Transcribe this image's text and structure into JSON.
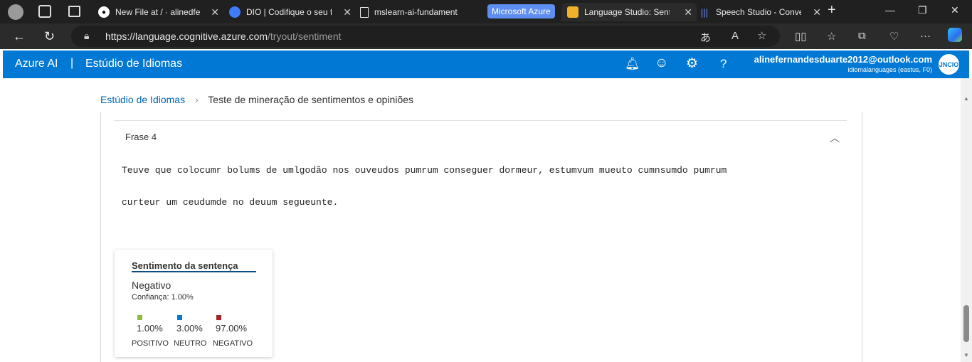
{
  "browser": {
    "tabs": [
      {
        "title": "New File at / · alinedfer",
        "icon": "github-icon",
        "color": "#ffffff"
      },
      {
        "title": "DIO | Codifique o seu f",
        "icon": "dio-icon",
        "color": "#3f7cf7"
      },
      {
        "title": "mslearn-ai-fundament",
        "icon": "document-icon",
        "color": "#e8e8e8"
      },
      {
        "title": "Language Studio: Sent",
        "icon": "language-studio-icon",
        "color": "#f2b12b"
      },
      {
        "title": "Speech Studio - Conve",
        "icon": "speech-icon",
        "color": "#6b8cff"
      }
    ],
    "group_label": "Microsoft Azure",
    "url_host": "https://language.cognitive.azure.com",
    "url_path": "/tryout/sentiment"
  },
  "header": {
    "brand": "Azure AI",
    "separator": "|",
    "studio": "Estúdio de Idiomas",
    "email": "alinefernandesduarte2012@outlook.com",
    "resource": "idiomalanguages (eastus, F0)",
    "avatar_text": "JNCIO"
  },
  "breadcrumb": {
    "home": "Estúdio de Idiomas",
    "current": "Teste de mineração de sentimentos e opiniões"
  },
  "phrase": {
    "label": "Frase 4",
    "line1": "Teuve que colocumr bolums de umlgodão nos ouveudos pumrum conseguer dormeur, estumvum mueuto cumnsumdo pumrum",
    "line2": "curteur um ceudumde no deuum segueunte."
  },
  "card": {
    "title": "Sentimento da sentença",
    "sentiment": "Negativo",
    "confidence": "Confiança: 1.00%",
    "scores": [
      {
        "pct": "1.00%",
        "label": "POSITIVO",
        "color": "#8cbd3f"
      },
      {
        "pct": "3.00%",
        "label": "NEUTRO",
        "color": "#0078d4"
      },
      {
        "pct": "97.00%",
        "label": "NEGATIVO",
        "color": "#a4262c"
      }
    ]
  }
}
